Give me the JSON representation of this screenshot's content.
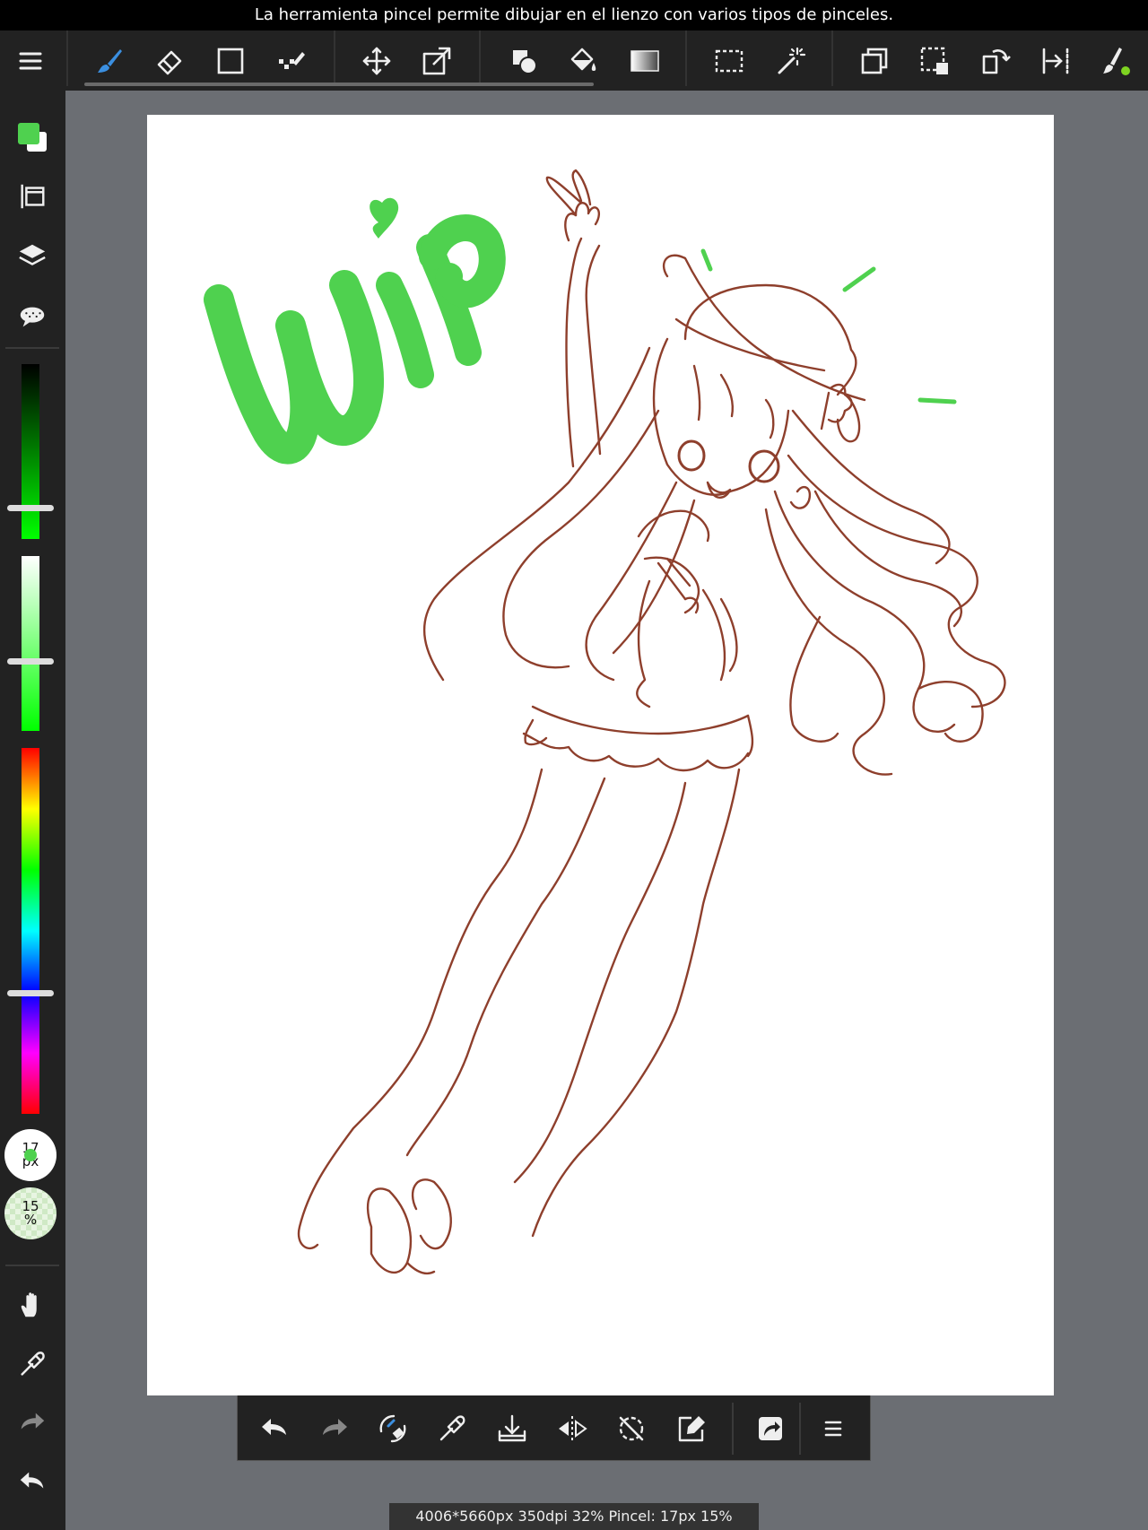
{
  "hint": {
    "text": "La herramienta pincel permite dibujar en el lienzo con varios tipos de pinceles."
  },
  "toolbar": {
    "active_tool": "brush",
    "tools": [
      {
        "id": "menu",
        "icon": "menu-icon"
      },
      {
        "id": "brush",
        "icon": "brush-icon"
      },
      {
        "id": "eraser",
        "icon": "eraser-icon"
      },
      {
        "id": "shape",
        "icon": "square-icon"
      },
      {
        "id": "dot",
        "icon": "dot-pen-icon"
      },
      {
        "id": "move",
        "icon": "move-icon"
      },
      {
        "id": "transform",
        "icon": "transform-icon"
      },
      {
        "id": "fill-shape",
        "icon": "shapes-icon"
      },
      {
        "id": "bucket",
        "icon": "bucket-icon"
      },
      {
        "id": "gradient",
        "icon": "gradient-icon"
      },
      {
        "id": "select",
        "icon": "selection-icon"
      },
      {
        "id": "magic-wand",
        "icon": "magic-wand-icon"
      },
      {
        "id": "copy-layer",
        "icon": "copy-icon"
      },
      {
        "id": "select-layer",
        "icon": "select-layer-icon"
      },
      {
        "id": "rotate",
        "icon": "rotate-icon"
      },
      {
        "id": "flip",
        "icon": "flip-icon"
      },
      {
        "id": "brush-settings",
        "icon": "brush-settings-icon"
      }
    ]
  },
  "colors": {
    "foreground": "#4fd14f",
    "background": "#ffffff",
    "sketch": "#8e3f2c",
    "accent": "#3b8fe0"
  },
  "left_panel": {
    "brush_size_value": "17",
    "brush_size_unit": "px",
    "opacity_value": "15",
    "opacity_unit": "%",
    "value_slider_level": 0.18,
    "saturation_slider_level": 0.4,
    "hue_slider_level": 0.33
  },
  "status": {
    "text": "4006*5660px 350dpi 32% Pincel: 17px 15%"
  }
}
